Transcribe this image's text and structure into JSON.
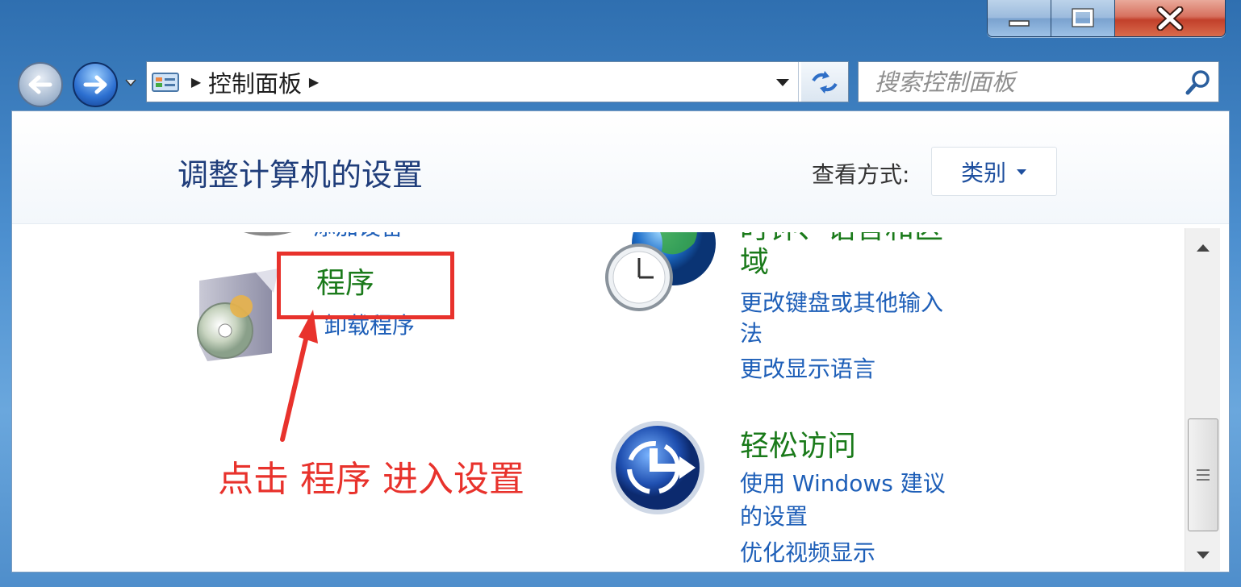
{
  "window": {
    "caption_buttons": [
      "minimize",
      "maximize",
      "close"
    ]
  },
  "nav": {
    "back_icon": "back-arrow-icon",
    "forward_icon": "forward-arrow-icon"
  },
  "address": {
    "breadcrumb": "控制面板",
    "separator": "▶"
  },
  "search": {
    "placeholder": "搜索控制面板"
  },
  "header": {
    "title": "调整计算机的设置",
    "view_by_label": "查看方式:",
    "view_by_value": "类别"
  },
  "categories": {
    "hardware": {
      "partial_link": "添加设备"
    },
    "programs": {
      "title": "程序",
      "links": [
        "卸载程序"
      ]
    },
    "clock": {
      "title_line1": "时钟、语言和区",
      "title_line2": "域",
      "links": [
        "更改键盘或其他输入",
        "法",
        "更改显示语言"
      ]
    },
    "ease": {
      "title": "轻松访问",
      "links": [
        "使用 Windows 建议",
        "的设置",
        "优化视频显示"
      ]
    }
  },
  "annotation": {
    "text": "点击 程序 进入设置",
    "color": "#e8322c"
  }
}
